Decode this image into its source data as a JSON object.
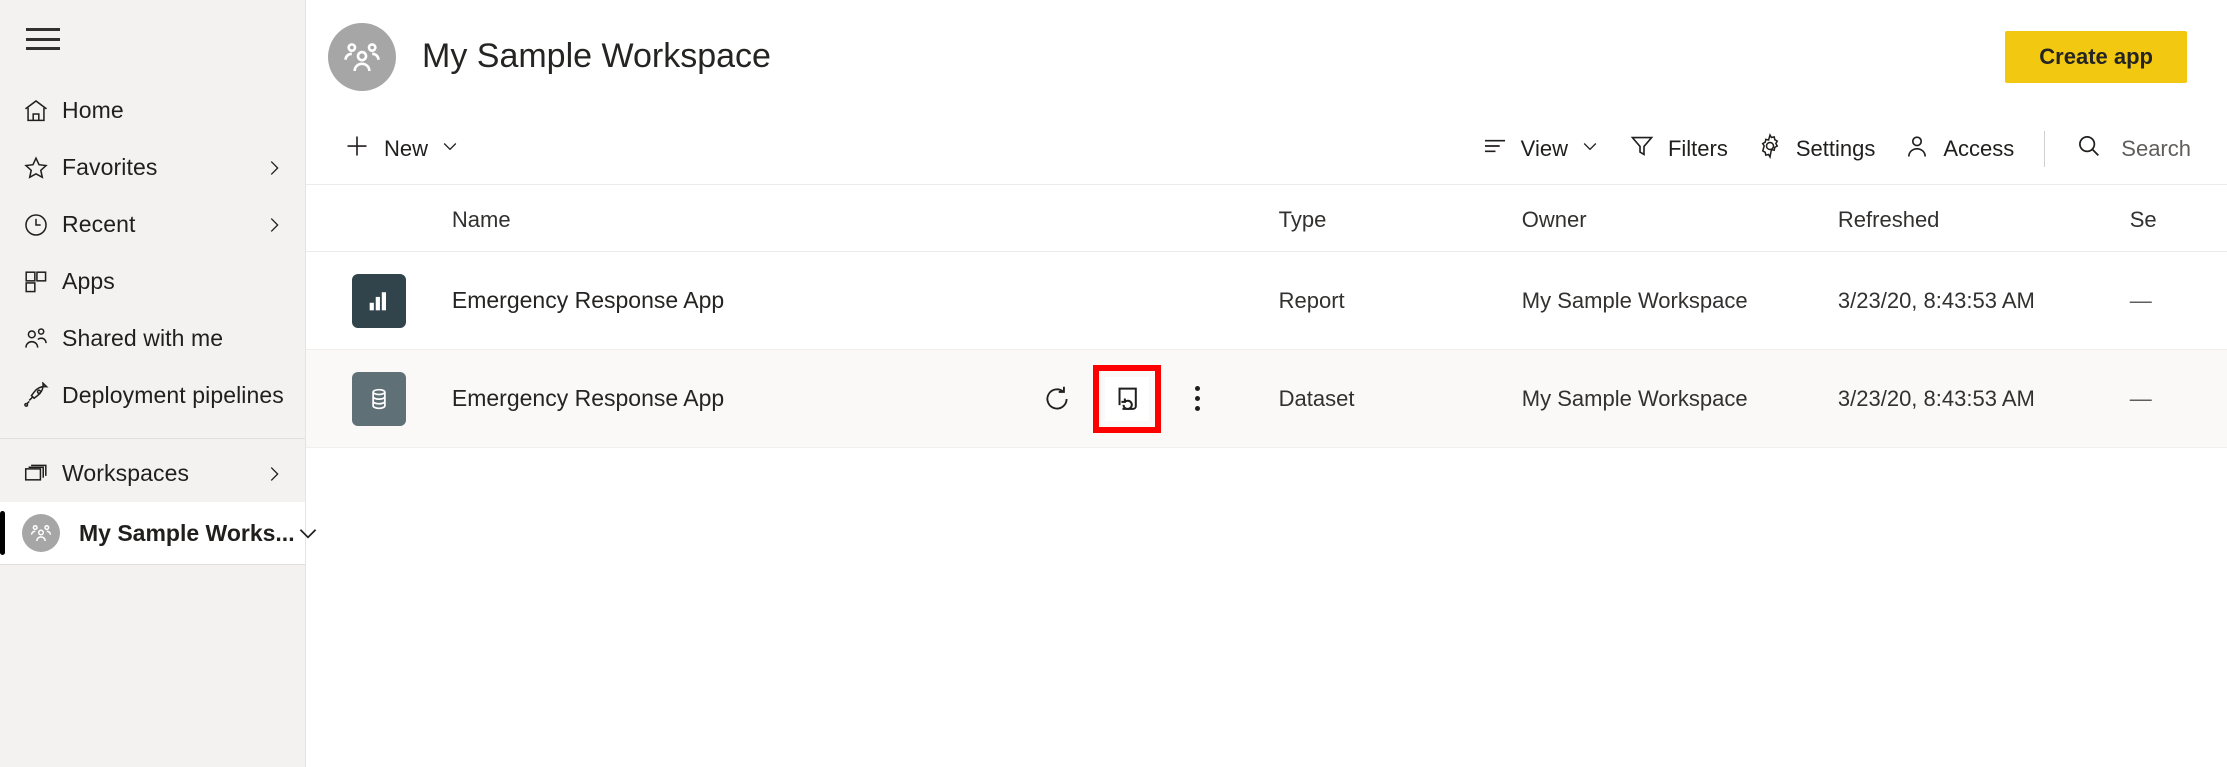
{
  "sidebar": {
    "menu_toggle": "hamburger-menu",
    "items": [
      {
        "label": "Home",
        "icon": "home-icon",
        "chevron": false
      },
      {
        "label": "Favorites",
        "icon": "star-icon",
        "chevron": true
      },
      {
        "label": "Recent",
        "icon": "clock-icon",
        "chevron": true
      },
      {
        "label": "Apps",
        "icon": "apps-grid-icon",
        "chevron": false
      },
      {
        "label": "Shared with me",
        "icon": "people-icon",
        "chevron": false
      },
      {
        "label": "Deployment pipelines",
        "icon": "rocket-icon",
        "chevron": false
      }
    ],
    "workspaces": {
      "label": "Workspaces",
      "icon": "stack-icon",
      "chevron": true
    },
    "current_workspace": {
      "label": "My Sample Works...",
      "icon": "workspace-avatar-icon",
      "chevron": "down"
    }
  },
  "header": {
    "avatar_icon": "workspace-group-icon",
    "title": "My Sample Workspace",
    "create_app_label": "Create app",
    "accent_yellow": "#F2C811"
  },
  "toolbar": {
    "new_label": "New",
    "view_label": "View",
    "filters_label": "Filters",
    "settings_label": "Settings",
    "access_label": "Access",
    "search_placeholder": "Search",
    "search_value": ""
  },
  "table": {
    "columns": [
      "Name",
      "Type",
      "Owner",
      "Refreshed",
      "Se"
    ],
    "rows": [
      {
        "icon": "report-barchart-icon",
        "icon_kind": "report",
        "name": "Emergency Response App",
        "type": "Report",
        "owner": "My Sample Workspace",
        "refreshed": "3/23/20, 8:43:53 AM",
        "sensitivity": "—",
        "hovered": false,
        "actions": []
      },
      {
        "icon": "dataset-database-icon",
        "icon_kind": "dataset",
        "name": "Emergency Response App",
        "type": "Dataset",
        "owner": "My Sample Workspace",
        "refreshed": "3/23/20, 8:43:53 AM",
        "sensitivity": "—",
        "hovered": true,
        "actions": [
          {
            "name": "refresh-now-icon",
            "highlighted": false
          },
          {
            "name": "schedule-refresh-icon",
            "highlighted": true
          },
          {
            "name": "more-options-icon",
            "highlighted": false
          }
        ]
      }
    ]
  },
  "annotation": {
    "highlight_color": "#FF0000",
    "target": "schedule-refresh-icon"
  }
}
